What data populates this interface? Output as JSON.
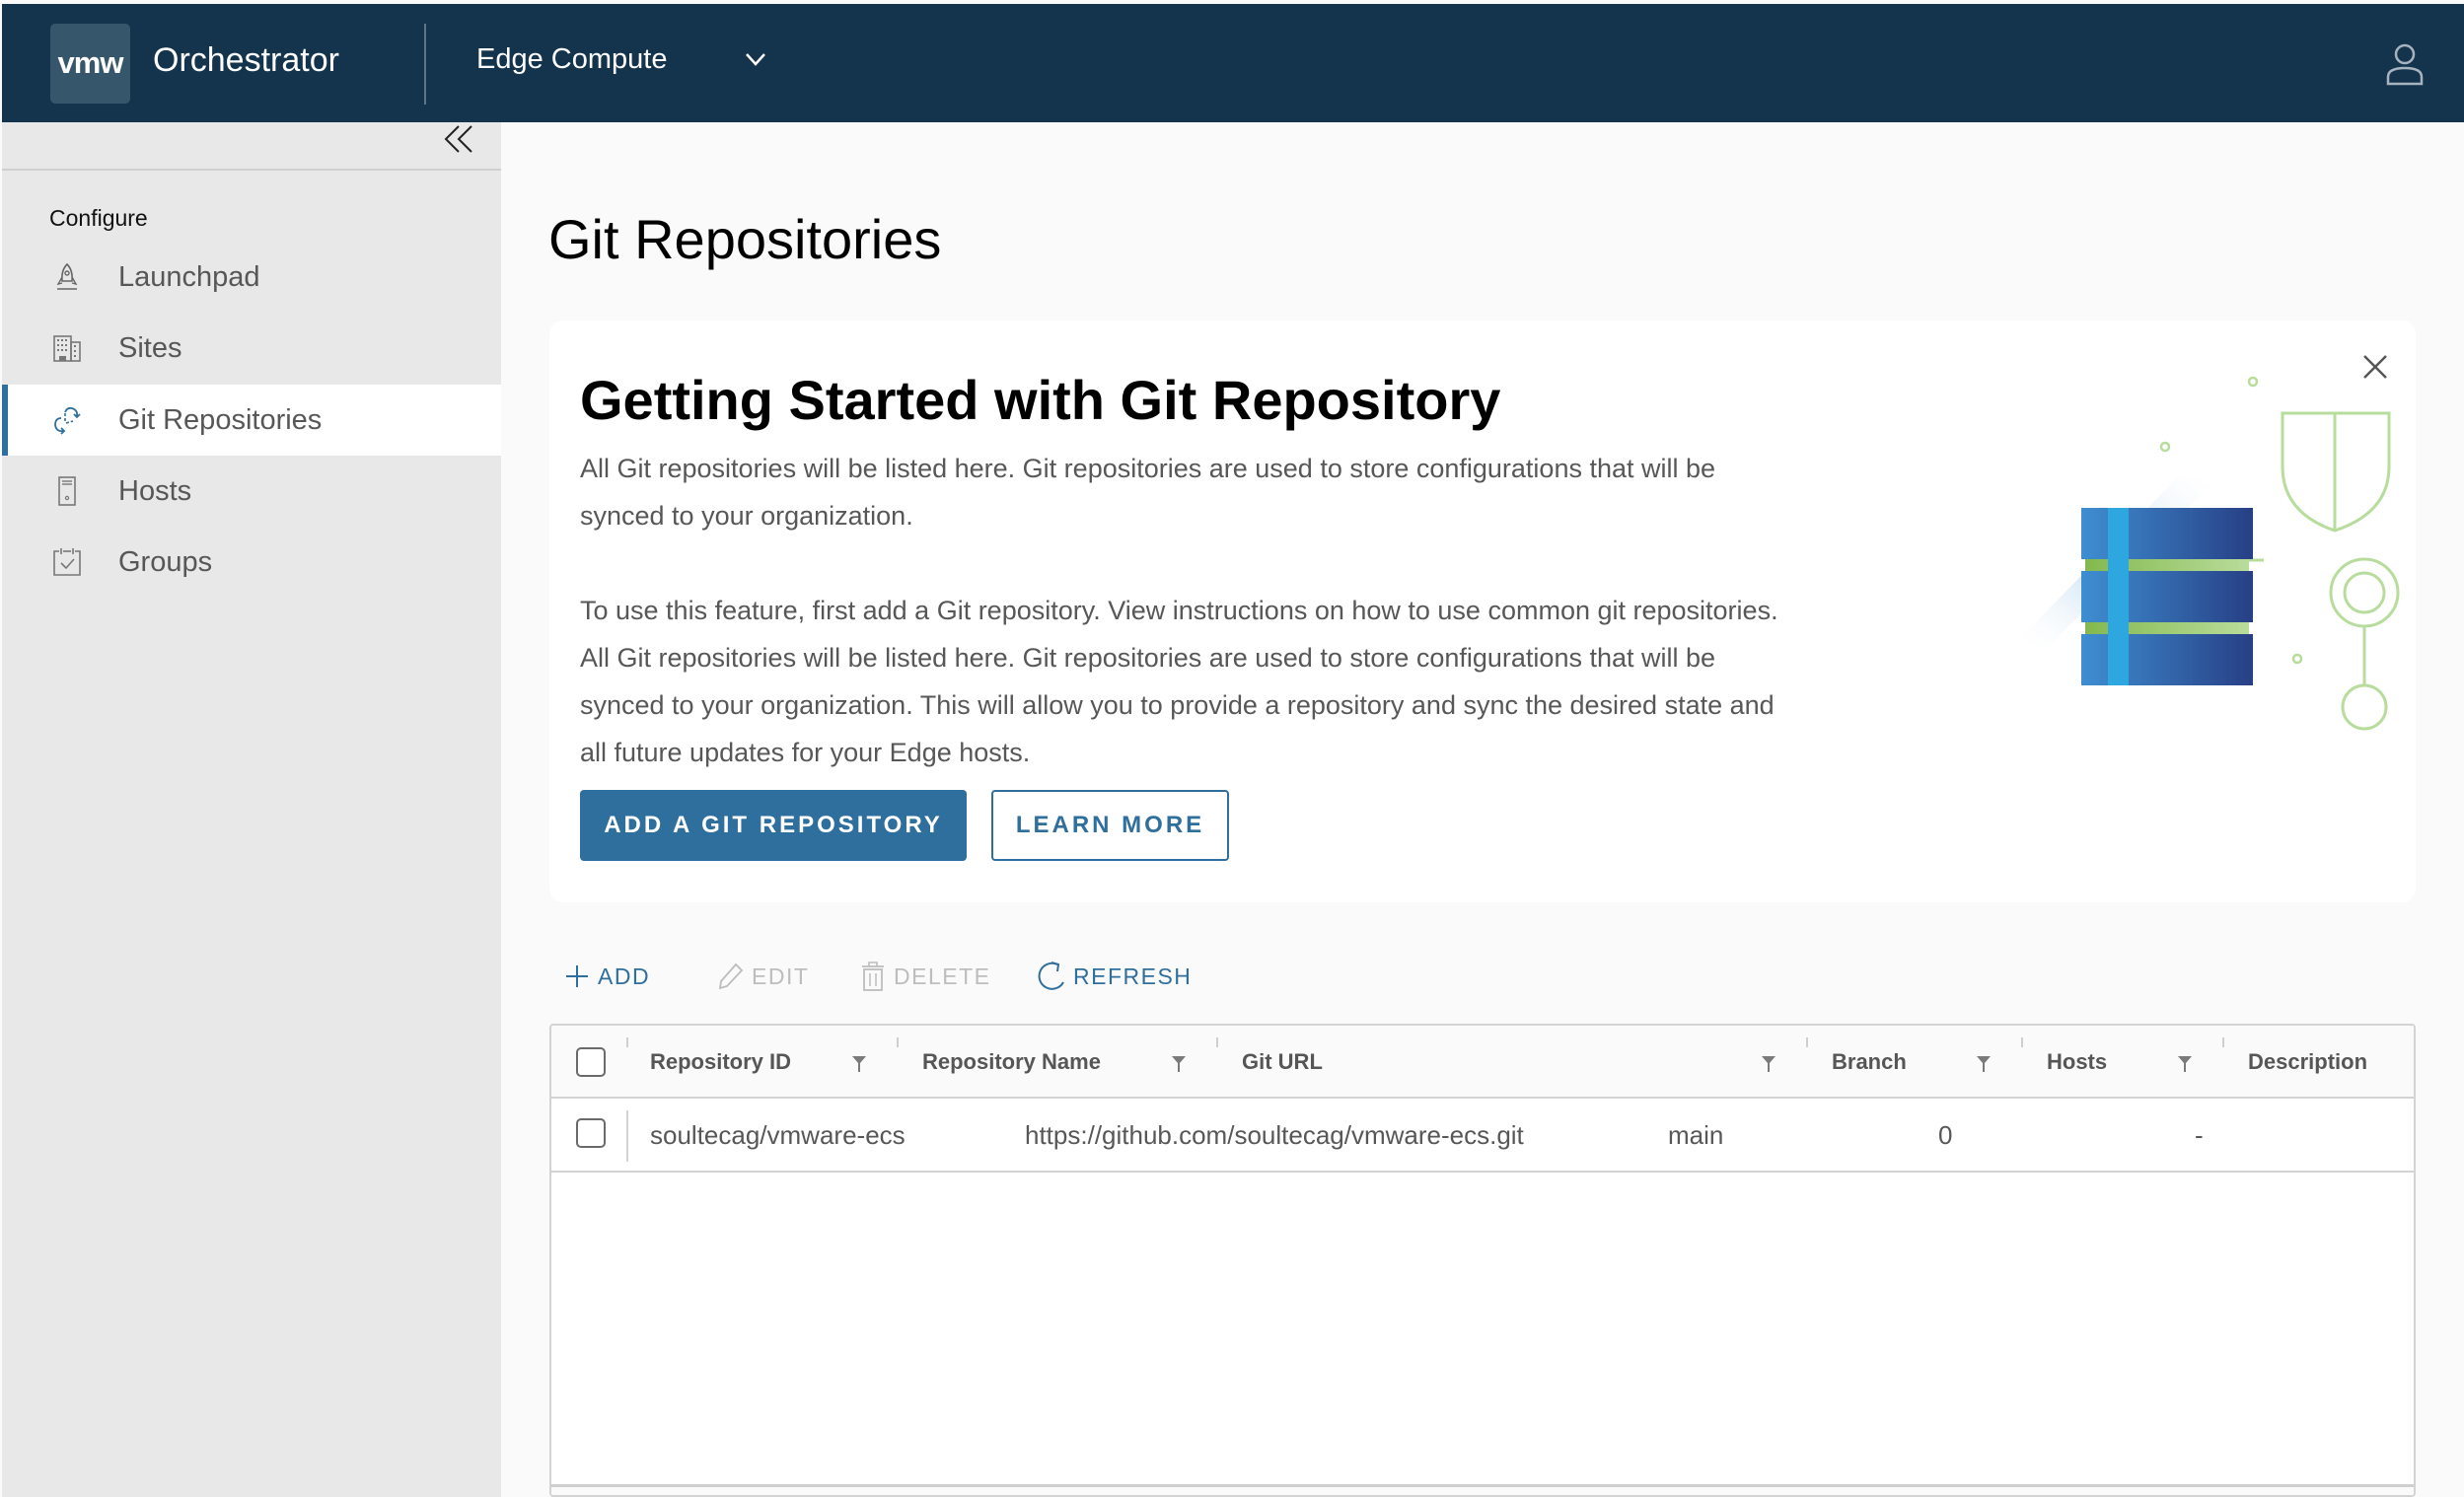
{
  "header": {
    "logo_text": "vmw",
    "app_title": "Orchestrator",
    "context_selector": "Edge Compute",
    "icons": {
      "context_chevron": "chevron-down-icon",
      "user": "user-icon"
    }
  },
  "sidebar": {
    "collapse_icon": "double-chevron-left-icon",
    "section_label": "Configure",
    "items": [
      {
        "label": "Launchpad",
        "icon": "rocket-icon",
        "active": false
      },
      {
        "label": "Sites",
        "icon": "building-icon",
        "active": false
      },
      {
        "label": "Git Repositories",
        "icon": "sync-icon",
        "active": true
      },
      {
        "label": "Hosts",
        "icon": "server-icon",
        "active": false
      },
      {
        "label": "Groups",
        "icon": "calendar-check-icon",
        "active": false
      }
    ]
  },
  "page": {
    "title": "Git Repositories"
  },
  "banner": {
    "title": "Getting Started with Git Repository",
    "paragraph1_lines": [
      "All Git repositories will be listed here. Git repositories are used to store configurations that will be",
      "synced to your organization."
    ],
    "paragraph2_lines": [
      "To use this feature, first add a Git repository. View instructions on how to use common git repositories.",
      "All Git repositories will be listed here. Git repositories are used to store configurations that will be",
      "synced to your organization. This will allow you to provide a repository and sync the desired state and",
      "all future updates for your Edge hosts."
    ],
    "primary_button": "ADD A GIT REPOSITORY",
    "secondary_button": "LEARN MORE",
    "close_icon": "close-icon",
    "illustration": "database-shield-network-illustration",
    "colors": {
      "primary": "#2f6f9e",
      "illustration_green": "#b7dc9c",
      "illustration_blue": "#3d8bd0"
    }
  },
  "toolbar": {
    "add": {
      "label": "ADD",
      "enabled": true,
      "icon": "plus-icon"
    },
    "edit": {
      "label": "EDIT",
      "enabled": false,
      "icon": "pencil-icon"
    },
    "delete": {
      "label": "DELETE",
      "enabled": false,
      "icon": "trash-icon"
    },
    "refresh": {
      "label": "REFRESH",
      "enabled": true,
      "icon": "refresh-icon"
    }
  },
  "table": {
    "columns": [
      "Repository ID",
      "Repository Name",
      "Git URL",
      "Branch",
      "Hosts",
      "Description"
    ],
    "rows": [
      {
        "repository_id": "soultecag/vmware-ecs",
        "git_url": "https://github.com/soultecag/vmware-ecs.git",
        "branch": "main",
        "hosts": "0",
        "description": "-"
      }
    ]
  }
}
